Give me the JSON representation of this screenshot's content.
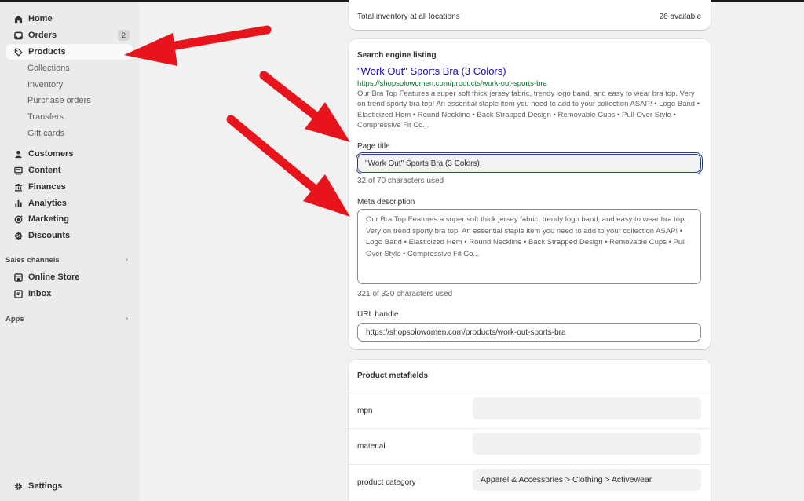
{
  "sidebar": {
    "items": [
      {
        "label": "Home",
        "icon": "home-icon"
      },
      {
        "label": "Orders",
        "icon": "inbox-icon",
        "badge": "2"
      },
      {
        "label": "Products",
        "icon": "tag-icon"
      },
      {
        "label": "Collections"
      },
      {
        "label": "Inventory"
      },
      {
        "label": "Purchase orders"
      },
      {
        "label": "Transfers"
      },
      {
        "label": "Gift cards"
      },
      {
        "label": "Customers",
        "icon": "person-icon"
      },
      {
        "label": "Content",
        "icon": "content-icon"
      },
      {
        "label": "Finances",
        "icon": "bank-icon"
      },
      {
        "label": "Analytics",
        "icon": "bar-chart-icon"
      },
      {
        "label": "Marketing",
        "icon": "target-icon"
      },
      {
        "label": "Discounts",
        "icon": "discount-icon"
      },
      {
        "label": "Online Store",
        "icon": "store-icon"
      },
      {
        "label": "Inbox",
        "icon": "chat-icon"
      },
      {
        "label": "Settings",
        "icon": "gear-icon"
      }
    ],
    "sales_channels": "Sales channels",
    "apps": "Apps",
    "chevron": "›"
  },
  "inventory": {
    "label": "Total inventory at all locations",
    "value": "26 available"
  },
  "seo": {
    "heading": "Search engine listing",
    "preview_title": "\"Work Out\" Sports Bra (3 Colors)",
    "preview_url": "https://shopsolowomen.com/products/work-out-sports-bra",
    "preview_description": "Our Bra Top Features a super soft thick jersey fabric, trendy logo band, and easy to wear bra top. Very on trend sporty bra top! An essential staple item you need to add to your collection ASAP! • Logo Band • Elasticized Hem • Round Neckline • Back Strapped Design • Removable Cups • Pull Over Style • Compressive Fit Co...",
    "page_title_label": "Page title",
    "page_title_value": "\"Work Out\" Sports Bra (3 Colors)",
    "page_title_count": "32 of 70 characters used",
    "meta_label": "Meta description",
    "meta_value": "Our Bra Top Features a super soft thick jersey fabric, trendy logo band, and easy to wear bra top. Very on trend sporty bra top! An essential staple item you need to add to your collection ASAP! • Logo Band • Elasticized Hem • Round Neckline • Back Strapped Design • Removable Cups • Pull Over Style • Compressive Fit Co...",
    "meta_count": "321 of 320 characters used",
    "url_label": "URL handle",
    "url_value": "https://shopsolowomen.com/products/work-out-sports-bra"
  },
  "metafields": {
    "heading": "Product metafields",
    "rows": [
      {
        "name": "mpn",
        "value": ""
      },
      {
        "name": "material",
        "value": ""
      },
      {
        "name": "product category",
        "value": "Apparel & Accessories > Clothing > Activewear"
      }
    ]
  },
  "colors": {
    "arrow": "#e8141b",
    "link_title": "#1a0dab",
    "link_url": "#0b6e2a",
    "focus_ring": "#2c3e82"
  }
}
